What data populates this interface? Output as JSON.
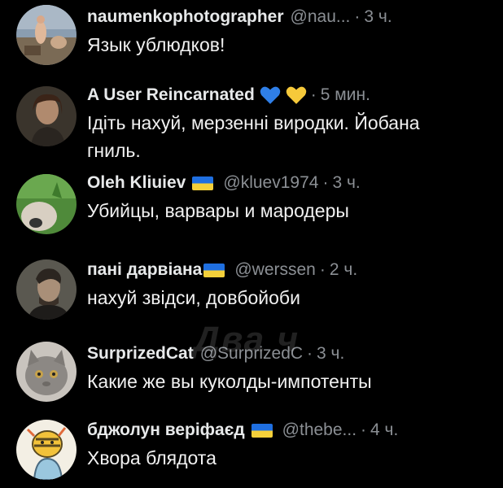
{
  "replies": [
    {
      "name": "naumenkophotographer",
      "handle": "@nau...",
      "time": "3 ч.",
      "text": "Язык ублюдков!",
      "avatar": "painting-avatar"
    },
    {
      "name": "A User Reincarnated",
      "hearts": [
        "blue-heart-icon",
        "yellow-heart-icon"
      ],
      "time": "5 мин.",
      "text": "Ідіть нахуй, мерзенні виродки. Йобана гниль.",
      "avatar": "woman-portrait-avatar"
    },
    {
      "name": "Oleh Kliuiev",
      "flag": "ukraine-flag-icon",
      "handle": "@kluev1974",
      "time": "3 ч.",
      "text": "Убийцы, варвары и мародеры",
      "avatar": "cat-in-grass-avatar"
    },
    {
      "name": "пані дарвіана",
      "flag": "ukraine-flag-icon",
      "handle": "@werssen",
      "time": "2 ч.",
      "text": "нахуй звідси, довбойоби",
      "avatar": "man-portrait-avatar"
    },
    {
      "name": "SurprizedCat",
      "handle": "@SurprizedC",
      "time": "3 ч.",
      "text": "Какие же вы куколды-импотенты",
      "avatar": "grey-cat-avatar"
    },
    {
      "name": "бджолун веріфаєд",
      "flag": "ukraine-flag-icon",
      "handle": "@thebe...",
      "time": "4 ч.",
      "text": "Хвора блядота",
      "avatar": "cartoon-bee-avatar"
    }
  ],
  "watermark": "Два ч",
  "colors": {
    "background": "#000000",
    "name": "#e7e9ea",
    "meta": "#8b8f94",
    "text": "#f1f1f1"
  }
}
